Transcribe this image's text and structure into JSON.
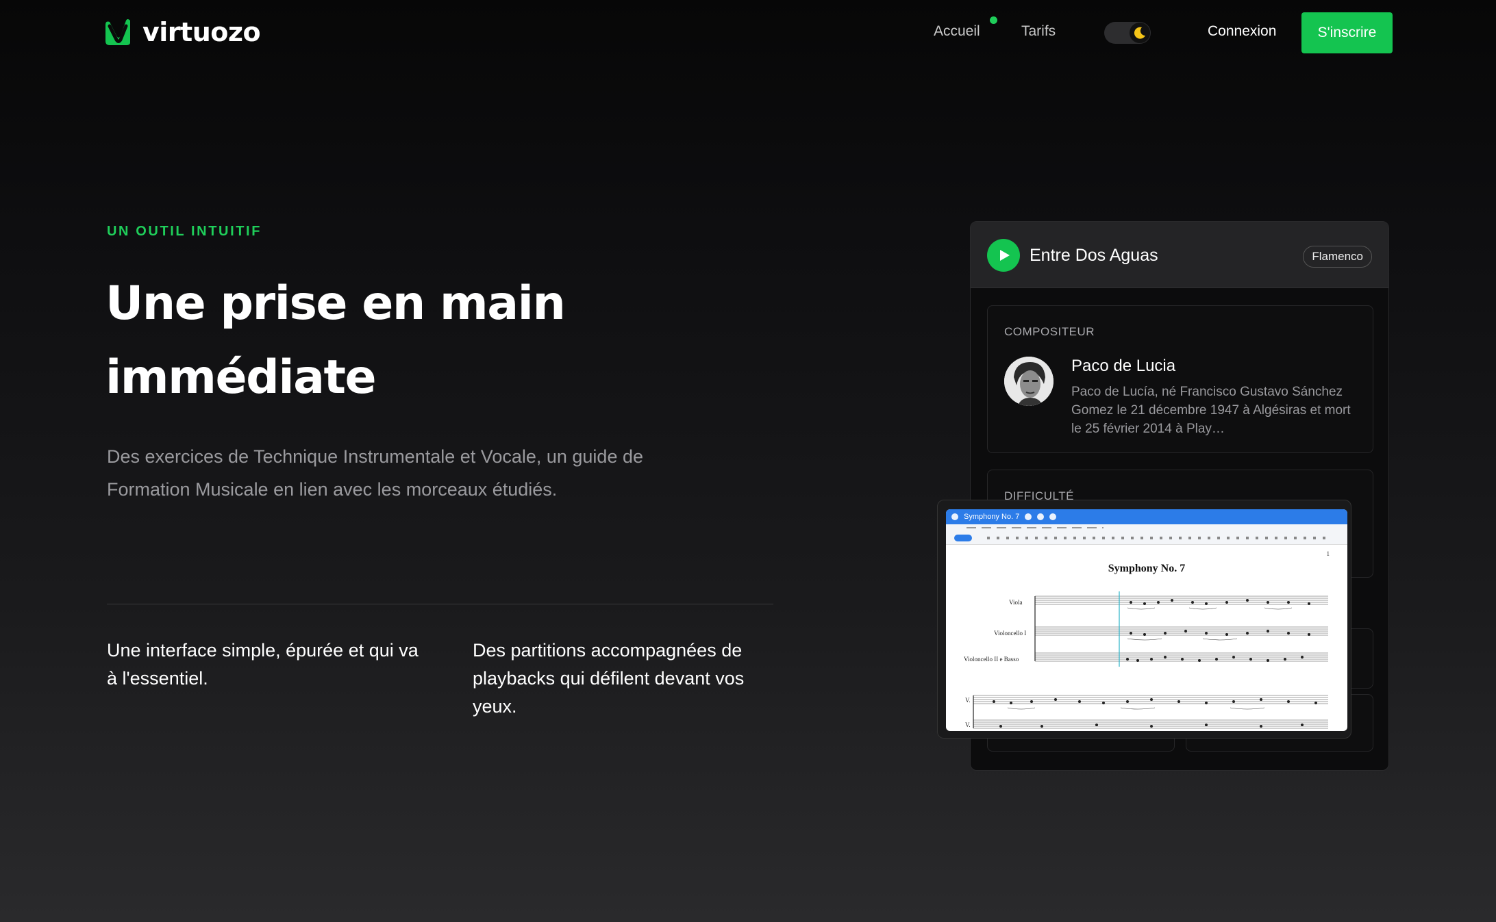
{
  "brand": {
    "name": "virtuozo",
    "accent": "#14c450"
  },
  "nav": {
    "accueil": "Accueil",
    "tarifs": "Tarifs",
    "theme_icon": "moon-icon",
    "connexion": "Connexion",
    "signup": "S'inscrire"
  },
  "hero": {
    "eyebrow": "UN OUTIL INTUITIF",
    "headline_line1": "Une prise en main",
    "headline_line2": "immédiate",
    "lead": "Des exercices de Technique Instrumentale et Vocale, un guide de Formation Musicale en lien avec les morceaux étudiés.",
    "feature1": "Une interface simple, épurée et qui va à l'essentiel.",
    "feature2": "Des partitions accompagnées de playbacks qui défilent devant vos yeux."
  },
  "piece": {
    "title": "Entre Dos Aguas",
    "genre": "Flamenco",
    "composer_label": "COMPOSITEUR",
    "composer_name": "Paco de Lucia",
    "composer_bio": "Paco de Lucía, né Francisco Gustavo Sánchez Gomez le 21 décembre 1947 à Algésiras et mort le 25 février 2014 à Play…",
    "difficulty_label": "DIFFICULTÉ"
  },
  "score": {
    "app_title": "Symphony No. 7",
    "title": "Symphony No. 7",
    "page_number": "1",
    "instruments": [
      "Viola",
      "Violoncello I",
      "Violoncello II e Basso"
    ],
    "system2_labels": [
      "V.",
      "V."
    ]
  }
}
